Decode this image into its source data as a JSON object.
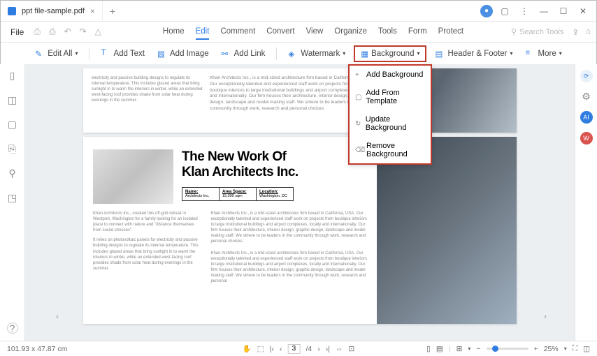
{
  "tab": {
    "title": "ppt file-sample.pdf"
  },
  "menubar": {
    "file": "File",
    "items": [
      "Home",
      "Edit",
      "Comment",
      "Convert",
      "View",
      "Organize",
      "Tools",
      "Form",
      "Protect"
    ],
    "active": "Edit",
    "search_placeholder": "Search Tools"
  },
  "toolbar": {
    "edit_all": "Edit All",
    "add_text": "Add Text",
    "add_image": "Add Image",
    "add_link": "Add Link",
    "watermark": "Watermark",
    "background": "Background",
    "header_footer": "Header & Footer",
    "more": "More"
  },
  "bg_menu": {
    "add": "Add Background",
    "template": "Add From Template",
    "update": "Update Background",
    "remove": "Remove Background"
  },
  "doc": {
    "p1_col1": "electricity and passive building designs to regulate its internal temperature. This includes glazed areas that bring sunlight in to warm the interiors in winter, while an extended west-facing roof provides shade from solar heat during evenings in the summer.",
    "p1_main": "Khan Architects Inc., is a mid-sized architecture firm based in California, USA. Our exceptionally talented and experienced staff work on projects from boutique interiors to large institutional buildings and airport complexes, locally and internationally. Our firm houses their architecture, interior design, graphic design, landscape and model making staff. We strieve to be leaders in the community through work, research and personal choices.",
    "p2_title1": "The New Work Of",
    "p2_title2": "Klan Architects Inc.",
    "headers": [
      "Name:",
      "Area Space:",
      "Location:"
    ],
    "values": [
      "Architects Inc.",
      "15,000 sqm",
      "Washington, DC"
    ],
    "p2_col1a": "Khan Architects Inc., created this off-grid retreat in Westport, Washington for a family looking for an isolated place to connect with nature and \"distance themselves from social stresses\".",
    "p2_col1b": "It relies on photovoltaic panels for electricity and passive building designs to regulate its internal temperature. This includes glazed areas that bring sunlight in to warm the interiors in winter, while an extended west-facing roof provides shade from solar heat during evenings in the summer.",
    "p2_main1": "Khan Architects Inc., is a mid-sized architecture firm based in California, USA. Our exceptionally talented and experienced staff work on projects from boutique interiors to large institutional buildings and airport complexes, locally and internationally. Our firm houses their architecture, interior design, graphic design, landscape and model making staff. We strieve to be leaders in the community through work, research and personal choices.",
    "p2_main2": "Khan Architects Inc., is a mid-sized architecture firm based in California, USA. Our exceptionally talented and experienced staff work on projects from boutique interiors to large institutional buildings and airport complexes, locally and internationally. Our firm houses their architecture, interior design, graphic design, landscape and model making staff. We strieve to be leaders in the community through work, research and personal"
  },
  "status": {
    "dimensions": "101.93 x 47.87 cm",
    "page": "3",
    "total_pages": "/4",
    "zoom": "25%"
  }
}
